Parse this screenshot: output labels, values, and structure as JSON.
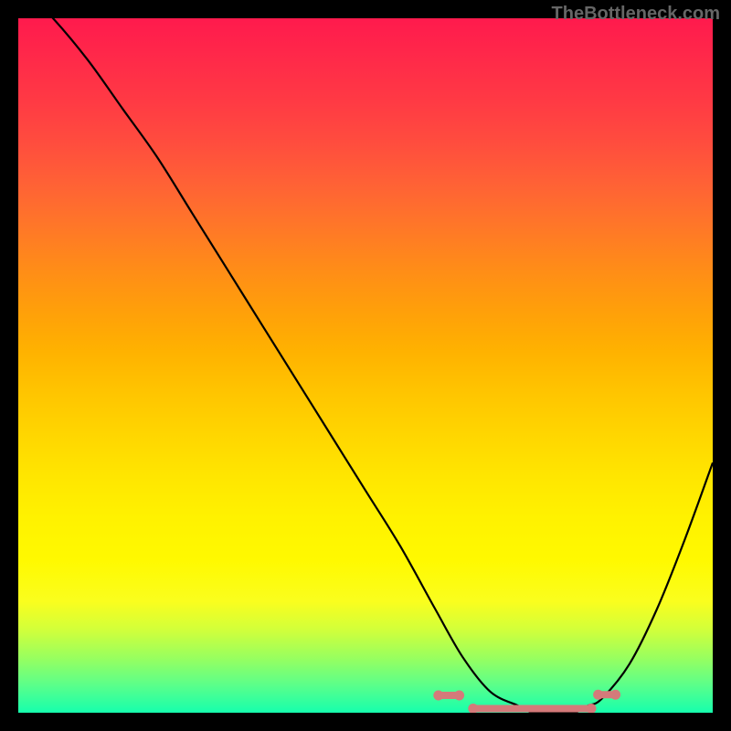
{
  "watermark": "TheBottleneck.com",
  "chart_data": {
    "type": "line",
    "title": "",
    "xlabel": "",
    "ylabel": "",
    "xlim": [
      0,
      100
    ],
    "ylim": [
      0,
      100
    ],
    "x": [
      0,
      5,
      10,
      15,
      20,
      25,
      30,
      35,
      40,
      45,
      50,
      55,
      60,
      64,
      68,
      72,
      74,
      76,
      80,
      82,
      84,
      88,
      92,
      96,
      100
    ],
    "values": [
      105,
      100,
      94,
      87,
      80,
      72,
      64,
      56,
      48,
      40,
      32,
      24,
      15,
      8,
      3,
      1,
      0,
      0,
      0,
      1,
      2,
      7,
      15,
      25,
      36
    ],
    "flat_zone_markers": {
      "color": "#d47a7a",
      "segments": [
        {
          "x_start": 60.5,
          "x_end": 63.5,
          "y": 2.5
        },
        {
          "x_start": 65.5,
          "x_end": 82.5,
          "y": 0.6
        },
        {
          "x_start": 83.5,
          "x_end": 86.0,
          "y": 2.6
        }
      ]
    }
  }
}
